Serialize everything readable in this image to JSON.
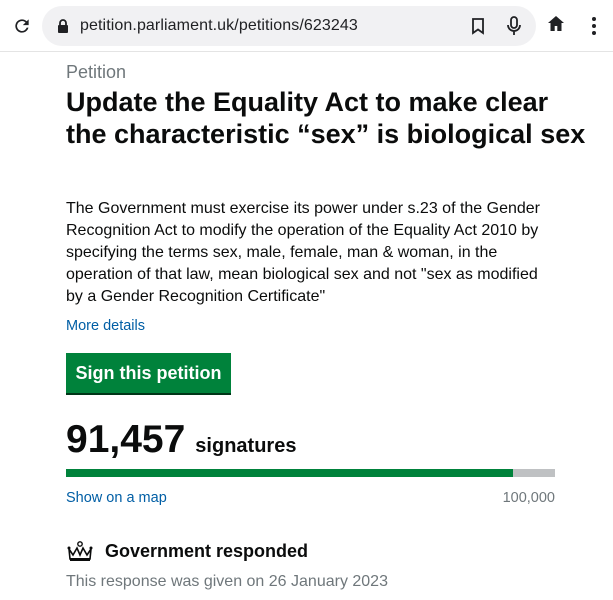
{
  "browser": {
    "url": "petition.parliament.uk/petitions/623243",
    "icons": [
      "reload-icon",
      "lock-icon",
      "bookmark-icon",
      "mic-icon",
      "home-icon",
      "menu-icon"
    ]
  },
  "petition": {
    "caption": "Petition",
    "title": "Update the Equality Act to make clear the characteristic “sex” is biological sex",
    "description": "The Government must exercise its power under s.23 of the Gender Recognition Act to modify the operation of the Equality Act 2010 by specifying the terms sex, male, female, man & woman, in the operation of that law, mean biological sex and not \"sex as modified by a Gender Recognition Certificate\"",
    "more_details": "More details",
    "sign_button": "Sign this petition",
    "signature_count": "91,457",
    "signature_label": "signatures",
    "progress_fraction": 0.91457,
    "show_on_map": "Show on a map",
    "target": "100,000",
    "response_heading": "Government responded",
    "response_date": "This response was given on 26 January 2023"
  },
  "colors": {
    "accent_green": "#00823b",
    "link_blue": "#005ea5",
    "progress_track": "#bfc1c3"
  }
}
